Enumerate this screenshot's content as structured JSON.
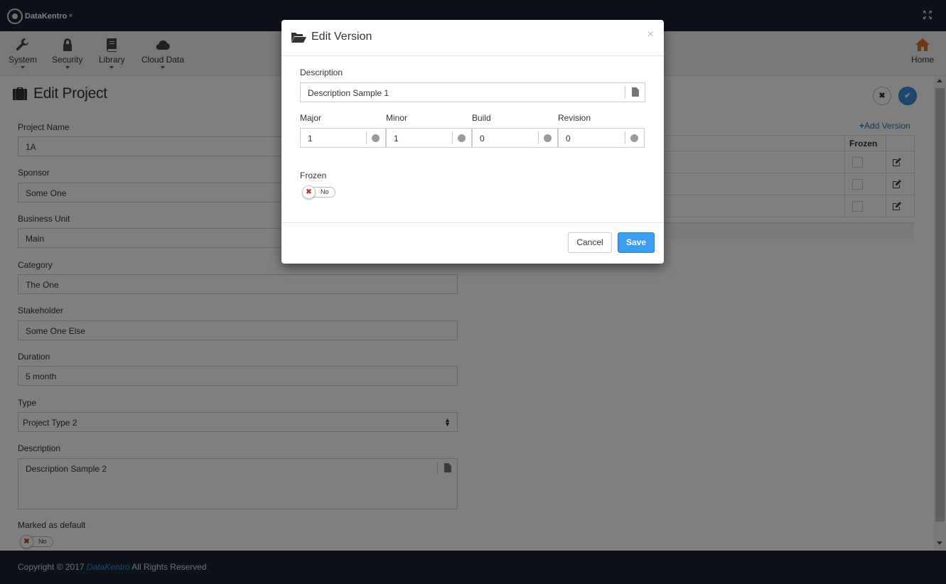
{
  "app": {
    "brand": "DataKentro"
  },
  "menu": {
    "items": [
      {
        "label": "System",
        "icon": "wrench-icon"
      },
      {
        "label": "Security",
        "icon": "lock-icon"
      },
      {
        "label": "Library",
        "icon": "book-icon"
      },
      {
        "label": "Cloud Data",
        "icon": "cloud-icon"
      }
    ],
    "home_label": "Home"
  },
  "page": {
    "title": "Edit Project",
    "fields": {
      "project_name_label": "Project Name",
      "project_name_value": "1A",
      "sponsor_label": "Sponsor",
      "sponsor_value": "Some One",
      "business_unit_label": "Business Unit",
      "business_unit_value": "Main",
      "category_label": "Category",
      "category_value": "The One",
      "stakeholder_label": "Stakeholder",
      "stakeholder_value": "Some One Else",
      "duration_label": "Duration",
      "duration_value": "5 month",
      "type_label": "Type",
      "type_value": "Project Type 2",
      "description_label": "Description",
      "description_value": "Description Sample 2",
      "default_label": "Marked as default",
      "default_toggle": "No"
    },
    "versions": {
      "add_label": "Add Version",
      "frozen_header": "Frozen"
    }
  },
  "modal": {
    "title": "Edit Version",
    "close": "×",
    "description_label": "Description",
    "description_value": "Description Sample 1",
    "major_label": "Major",
    "major_value": "1",
    "minor_label": "Minor",
    "minor_value": "1",
    "build_label": "Build",
    "build_value": "0",
    "revision_label": "Revision",
    "revision_value": "0",
    "frozen_label": "Frozen",
    "frozen_toggle": "No",
    "cancel_label": "Cancel",
    "save_label": "Save"
  },
  "footer": {
    "prefix": "Copyright © 2017",
    "brand": "DataKentro",
    "suffix": "All Rights Reserved"
  },
  "colors": {
    "topbar": "#1b2535",
    "accent": "#3a9df0",
    "link": "#2e6fb3"
  }
}
